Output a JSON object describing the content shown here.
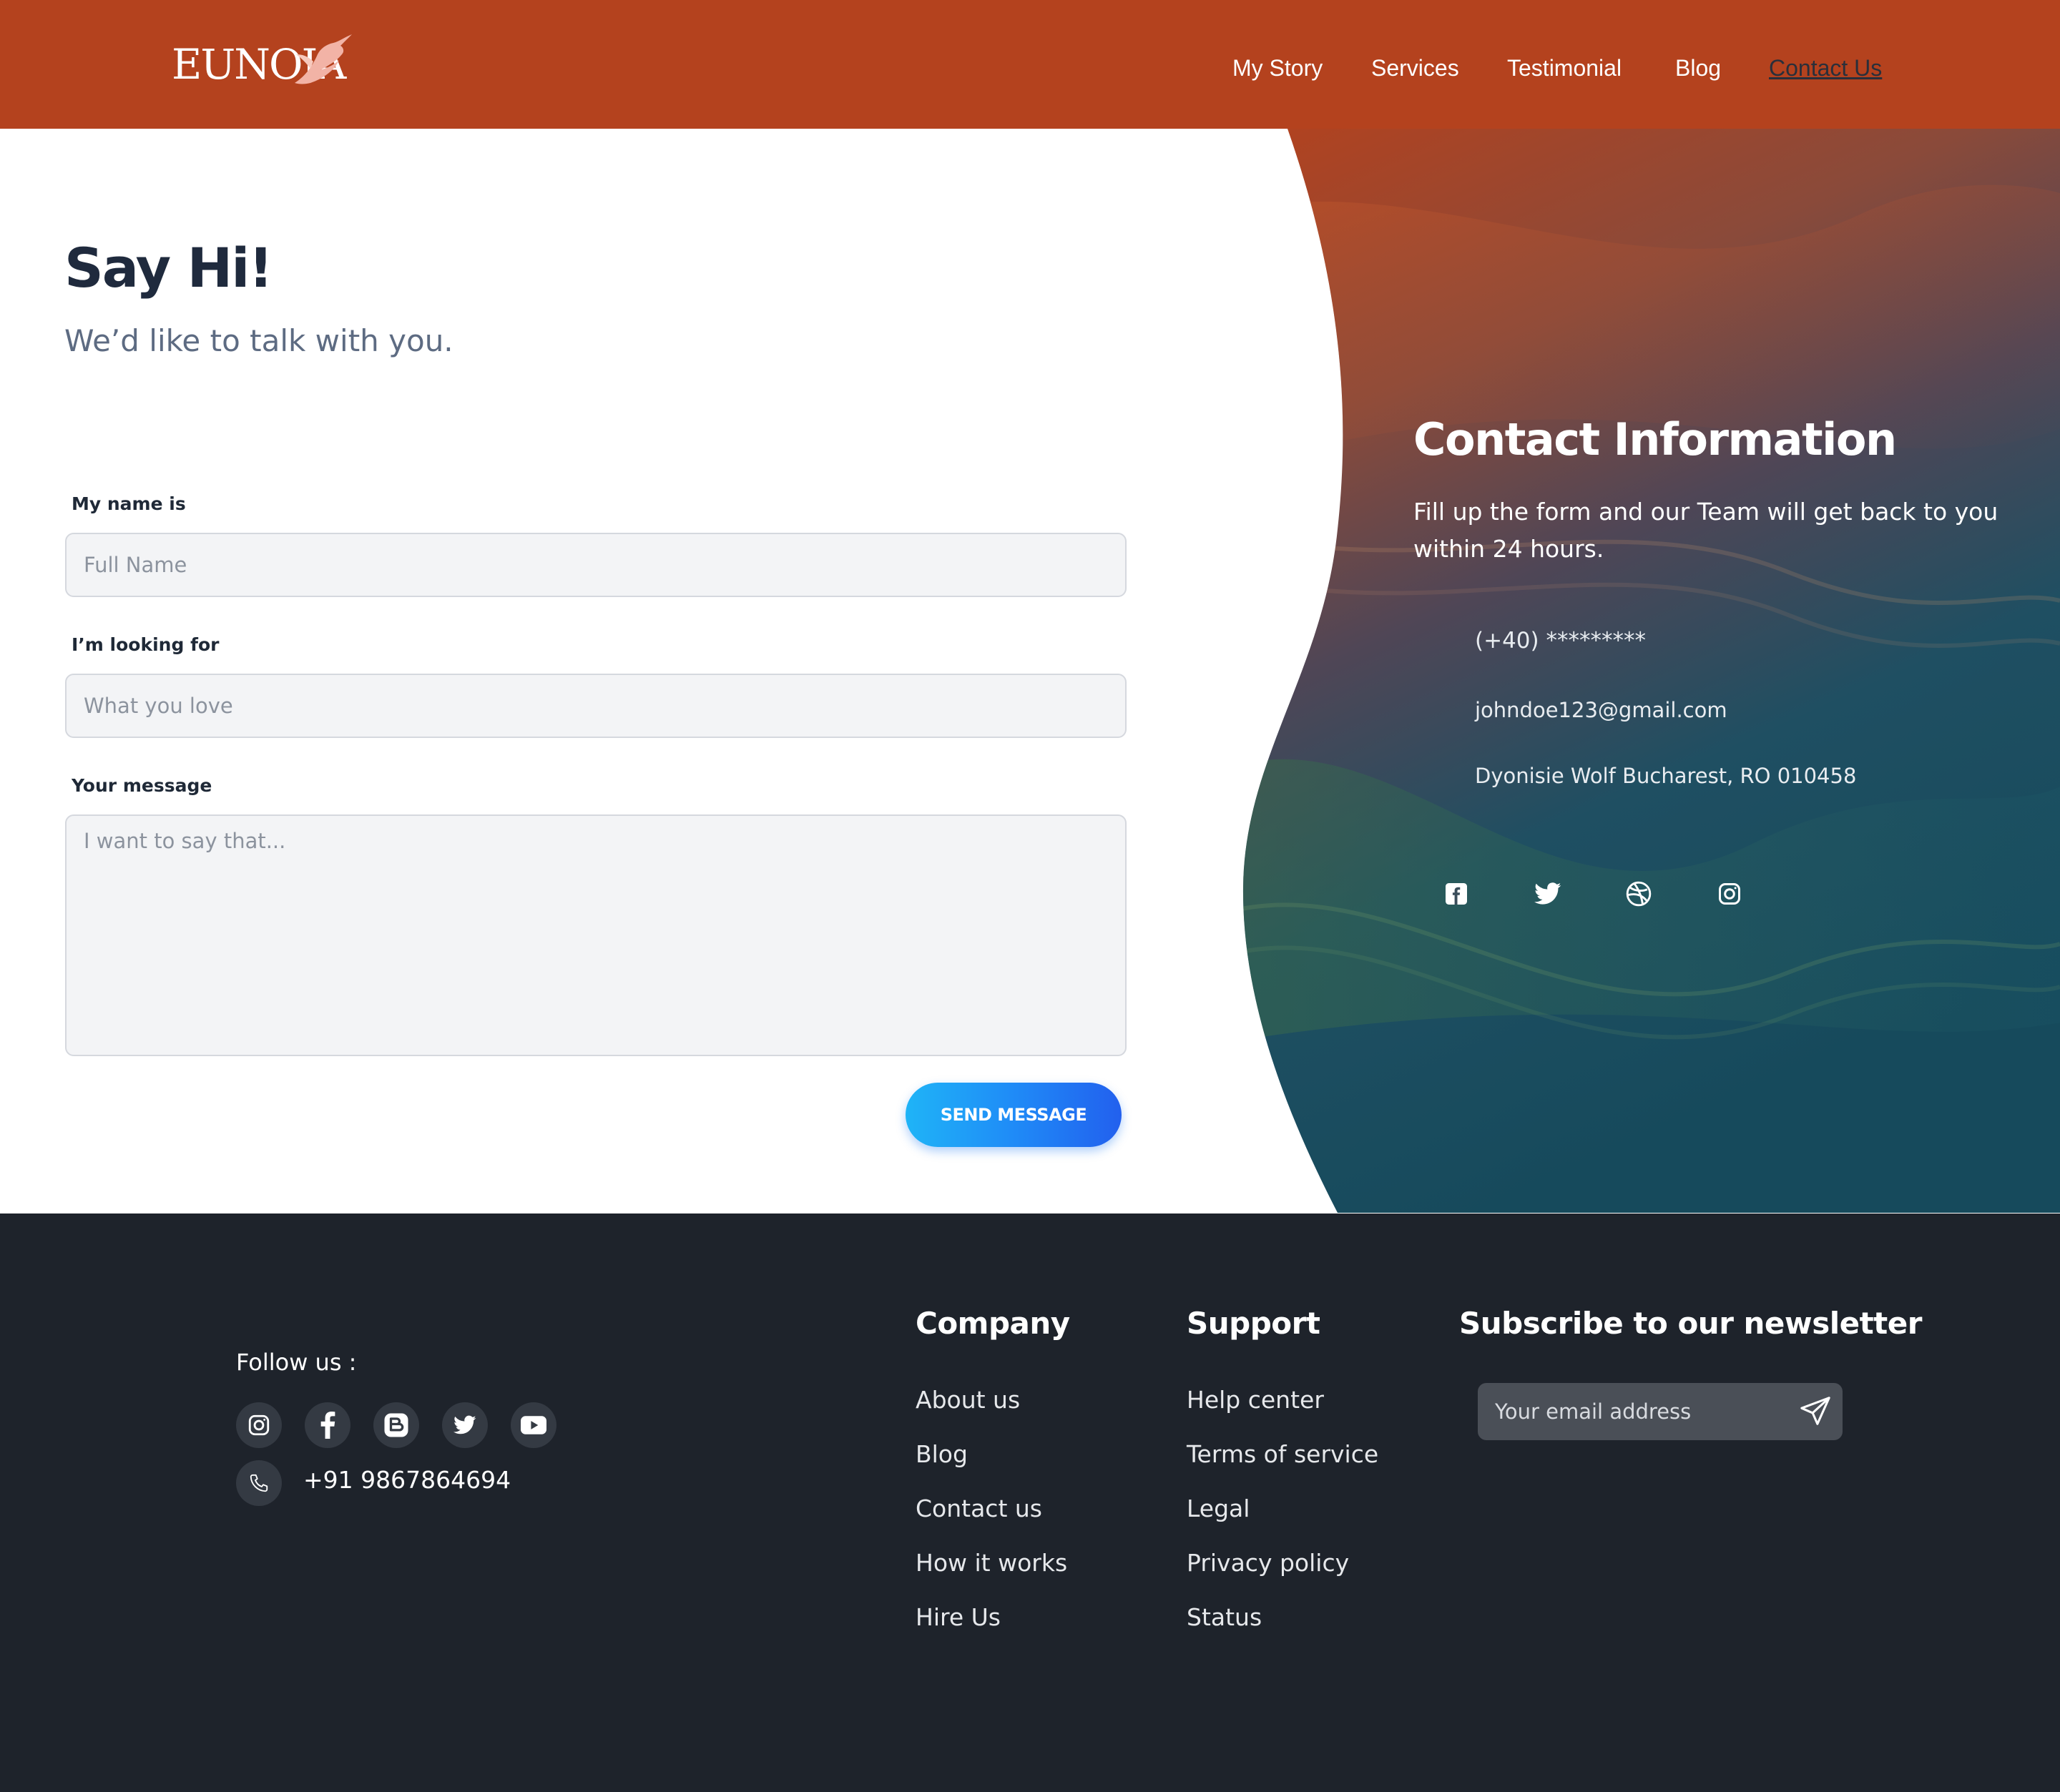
{
  "header": {
    "logo_text": "EUNOIA",
    "nav": [
      {
        "label": "My Story"
      },
      {
        "label": "Services"
      },
      {
        "label": "Testimonial"
      },
      {
        "label": "Blog"
      },
      {
        "label": "Contact Us",
        "active": true
      }
    ]
  },
  "form": {
    "title": "Say Hi!",
    "subtitle": "We’d like to talk with you.",
    "name_label": "My name is",
    "name_placeholder": "Full Name",
    "looking_label": "I’m looking for",
    "looking_placeholder": "What you love",
    "message_label": "Your message",
    "message_placeholder": "I want to say that...",
    "submit_label": "SEND MESSAGE"
  },
  "contact": {
    "title": "Contact Information",
    "description": "Fill up the form and our Team will get back to you within 24 hours.",
    "phone": "(+40) *********",
    "email": "johndoe123@gmail.com",
    "address": "Dyonisie Wolf Bucharest, RO 010458",
    "socials": [
      "facebook-icon",
      "twitter-icon",
      "dribbble-icon",
      "instagram-icon"
    ]
  },
  "footer": {
    "follow_label": "Follow us :",
    "socials": [
      "instagram-icon",
      "facebook-icon",
      "blogger-icon",
      "twitter-icon",
      "youtube-icon"
    ],
    "phone": "+91 9867864694",
    "company": {
      "title": "Company",
      "links": [
        "About us",
        "Blog",
        "Contact us",
        "How it works",
        "Hire Us"
      ]
    },
    "support": {
      "title": "Support",
      "links": [
        "Help center",
        "Terms of service",
        "Legal",
        "Privacy policy",
        "Status"
      ]
    },
    "newsletter": {
      "title": "Subscribe to our newsletter",
      "placeholder": "Your email address"
    }
  },
  "colors": {
    "header_bg": "#b4421e",
    "footer_bg": "#1e232b",
    "accent_blue": "#1f8bf7"
  }
}
